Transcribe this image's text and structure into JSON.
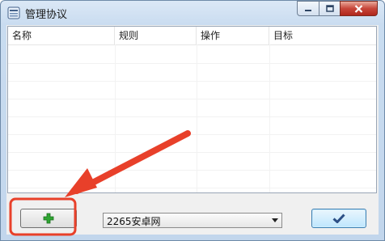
{
  "window": {
    "title": "管理协议",
    "app_icon": "window-list-icon",
    "controls": {
      "minimize": "minimize-icon",
      "maximize": "maximize-icon",
      "close": "close-icon"
    }
  },
  "table": {
    "columns": [
      "名称",
      "规则",
      "操作",
      "目标"
    ],
    "rows": []
  },
  "footer": {
    "add_button_icon": "plus-icon",
    "select": {
      "selected": "2265安卓网"
    },
    "ok_button_icon": "checkmark-icon"
  },
  "annotation": {
    "color": "#e8402a",
    "arrow_target": "add-button"
  }
}
